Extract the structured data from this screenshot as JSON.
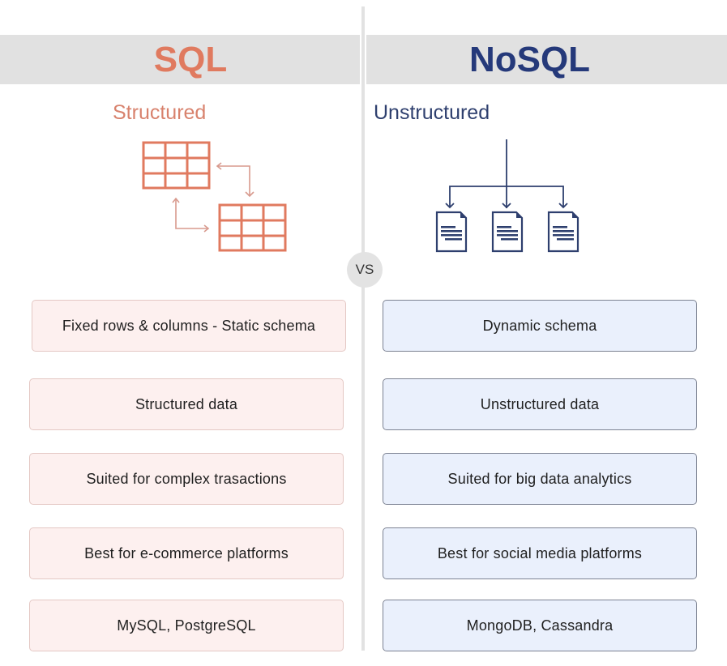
{
  "colors": {
    "sql_accent": "#e07a5f",
    "nosql_accent": "#25397a",
    "header_bg": "#e1e1e1",
    "sql_card_bg": "#fdf0ef",
    "nosql_card_bg": "#eaf0fc"
  },
  "sql": {
    "title": "SQL",
    "subtitle": "Structured",
    "illustration_icon": "linked-tables-icon",
    "features": [
      "Fixed rows & columns - Static schema",
      "Structured data",
      "Suited for complex trasactions",
      "Best for e-commerce platforms",
      "MySQL, PostgreSQL"
    ]
  },
  "vs_label": "VS",
  "nosql": {
    "title": "NoSQL",
    "subtitle": "Unstructured",
    "illustration_icon": "document-tree-icon",
    "features": [
      "Dynamic schema",
      "Unstructured data",
      "Suited for big data analytics",
      "Best for social media platforms",
      "MongoDB, Cassandra"
    ]
  }
}
